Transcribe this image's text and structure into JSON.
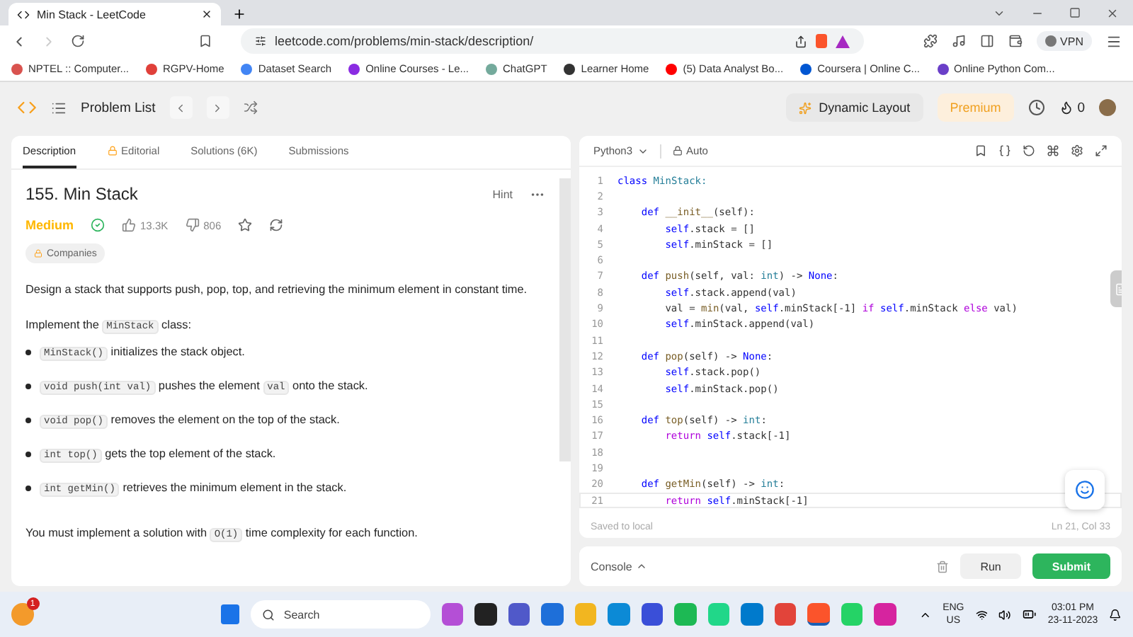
{
  "browser": {
    "tab_title": "Min Stack - LeetCode",
    "url": "leetcode.com/problems/min-stack/description/",
    "vpn": "VPN",
    "bookmarks": [
      {
        "label": "NPTEL :: Computer...",
        "color": "#d9534f"
      },
      {
        "label": "RGPV-Home",
        "color": "#e0403a"
      },
      {
        "label": "Dataset Search",
        "color": "#4285f4"
      },
      {
        "label": "Online Courses - Le...",
        "color": "#8a2be2"
      },
      {
        "label": "ChatGPT",
        "color": "#74aa9c"
      },
      {
        "label": "Learner Home",
        "color": "#333333"
      },
      {
        "label": "(5) Data Analyst Bo...",
        "color": "#ff0000"
      },
      {
        "label": "Coursera | Online C...",
        "color": "#0056d2"
      },
      {
        "label": "Online Python Com...",
        "color": "#6a3fc8"
      }
    ]
  },
  "header": {
    "problem_list": "Problem List",
    "dynamic_layout": "Dynamic Layout",
    "premium": "Premium",
    "streak": "0"
  },
  "tabs": [
    {
      "label": "Description",
      "selected": true,
      "locked": false
    },
    {
      "label": "Editorial",
      "selected": false,
      "locked": true
    },
    {
      "label": "Solutions (6K)",
      "selected": false,
      "locked": false
    },
    {
      "label": "Submissions",
      "selected": false,
      "locked": false
    }
  ],
  "problem": {
    "title": "155. Min Stack",
    "hint": "Hint",
    "difficulty": "Medium",
    "solved": true,
    "likes": "13.3K",
    "dislikes": "806",
    "companies": "Companies",
    "paragraphs": [
      {
        "kind": "para",
        "segs": [
          {
            "text": "Design a stack that supports push, pop, top, and retrieving the minimum element in constant time."
          }
        ]
      },
      {
        "kind": "para",
        "segs": [
          {
            "text": "Implement the "
          },
          {
            "code": "MinStack"
          },
          {
            "text": " class:"
          }
        ]
      },
      {
        "kind": "bullet",
        "segs": [
          {
            "code": "MinStack()"
          },
          {
            "text": " initializes the stack object."
          }
        ]
      },
      {
        "kind": "bullet",
        "segs": [
          {
            "code": "void push(int val)"
          },
          {
            "text": " pushes the element "
          },
          {
            "code": "val"
          },
          {
            "text": " onto the stack."
          }
        ]
      },
      {
        "kind": "bullet",
        "segs": [
          {
            "code": "void pop()"
          },
          {
            "text": " removes the element on the top of the stack."
          }
        ]
      },
      {
        "kind": "bullet",
        "segs": [
          {
            "code": "int top()"
          },
          {
            "text": " gets the top element of the stack."
          }
        ]
      },
      {
        "kind": "bullet",
        "segs": [
          {
            "code": "int getMin()"
          },
          {
            "text": " retrieves the minimum element in the stack."
          }
        ]
      },
      {
        "kind": "para",
        "segs": [
          {
            "text": "You must implement a solution with "
          },
          {
            "code": "O(1)"
          },
          {
            "text": " time complexity for each function."
          }
        ]
      }
    ]
  },
  "editor": {
    "language": "Python3",
    "mode": "Auto",
    "saved": "Saved to local",
    "cursor": "Ln 21, Col 33",
    "lines": [
      {
        "n": "1",
        "segs": [
          {
            "kw": "class "
          },
          {
            "cls": "MinStack:"
          }
        ]
      },
      {
        "n": "2"
      },
      {
        "n": "3",
        "segs": [
          {
            "kw": "    def "
          },
          {
            "fn": "__init__"
          },
          {
            "pl": "(self):"
          }
        ]
      },
      {
        "n": "4",
        "segs": [
          {
            "self": "        self"
          },
          {
            "pl": ".stack = []"
          }
        ]
      },
      {
        "n": "5",
        "segs": [
          {
            "self": "        self"
          },
          {
            "pl": ".minStack = []"
          }
        ]
      },
      {
        "n": "6"
      },
      {
        "n": "7",
        "segs": [
          {
            "kw": "    def "
          },
          {
            "fn": "push"
          },
          {
            "pl": "(self, val: "
          },
          {
            "cls": "int"
          },
          {
            "pl": ") -> "
          },
          {
            "kw": "None"
          },
          {
            "pl": ":"
          }
        ]
      },
      {
        "n": "8",
        "segs": [
          {
            "self": "        self"
          },
          {
            "pl": ".stack.append(val)"
          }
        ]
      },
      {
        "n": "9",
        "segs": [
          {
            "pl": "        val = "
          },
          {
            "fn": "min"
          },
          {
            "pl": "(val, "
          },
          {
            "self": "self"
          },
          {
            "pl": ".minStack[-1] "
          },
          {
            "ctl": "if "
          },
          {
            "self": "self"
          },
          {
            "pl": ".minStack "
          },
          {
            "ctl": "else"
          },
          {
            "pl": " val)"
          }
        ]
      },
      {
        "n": "10",
        "segs": [
          {
            "self": "        self"
          },
          {
            "pl": ".minStack.append(val)"
          }
        ]
      },
      {
        "n": "11"
      },
      {
        "n": "12",
        "segs": [
          {
            "kw": "    def "
          },
          {
            "fn": "pop"
          },
          {
            "pl": "(self) -> "
          },
          {
            "kw": "None"
          },
          {
            "pl": ":"
          }
        ]
      },
      {
        "n": "13",
        "segs": [
          {
            "self": "        self"
          },
          {
            "pl": ".stack.pop()"
          }
        ]
      },
      {
        "n": "14",
        "segs": [
          {
            "self": "        self"
          },
          {
            "pl": ".minStack.pop()"
          }
        ]
      },
      {
        "n": "15"
      },
      {
        "n": "16",
        "segs": [
          {
            "kw": "    def "
          },
          {
            "fn": "top"
          },
          {
            "pl": "(self) -> "
          },
          {
            "cls": "int"
          },
          {
            "pl": ":"
          }
        ]
      },
      {
        "n": "17",
        "segs": [
          {
            "ctl": "        return "
          },
          {
            "self": "self"
          },
          {
            "pl": ".stack[-1]"
          }
        ]
      },
      {
        "n": "18"
      },
      {
        "n": "19"
      },
      {
        "n": "20",
        "segs": [
          {
            "kw": "    def "
          },
          {
            "fn": "getMin"
          },
          {
            "pl": "(self) -> "
          },
          {
            "cls": "int"
          },
          {
            "pl": ":"
          }
        ]
      },
      {
        "n": "21",
        "segs": [
          {
            "ctl": "        return "
          },
          {
            "self": "self"
          },
          {
            "pl": ".minStack[-1]"
          }
        ]
      }
    ]
  },
  "console": {
    "label": "Console",
    "run": "Run",
    "submit": "Submit"
  },
  "taskbar": {
    "search": "Search",
    "notifications": "1",
    "lang": "ENG",
    "region": "US",
    "time": "03:01 PM",
    "date": "23-11-2023",
    "apps": [
      {
        "color": "#b44fd6",
        "active": false
      },
      {
        "color": "#222222",
        "active": false
      },
      {
        "color": "#5059c9",
        "active": false
      },
      {
        "color": "#1e6fd9",
        "active": false
      },
      {
        "color": "#f2b620",
        "active": false
      },
      {
        "color": "#0c8ad6",
        "active": false
      },
      {
        "color": "#3a4fd8",
        "active": false
      },
      {
        "color": "#1db954",
        "active": false
      },
      {
        "color": "#21d789",
        "active": false
      },
      {
        "color": "#007acc",
        "active": false
      },
      {
        "color": "#e2443a",
        "active": false
      },
      {
        "color": "#fb542b",
        "active": true
      },
      {
        "color": "#25d366",
        "active": false
      },
      {
        "color": "#d6249f",
        "active": false
      }
    ]
  }
}
